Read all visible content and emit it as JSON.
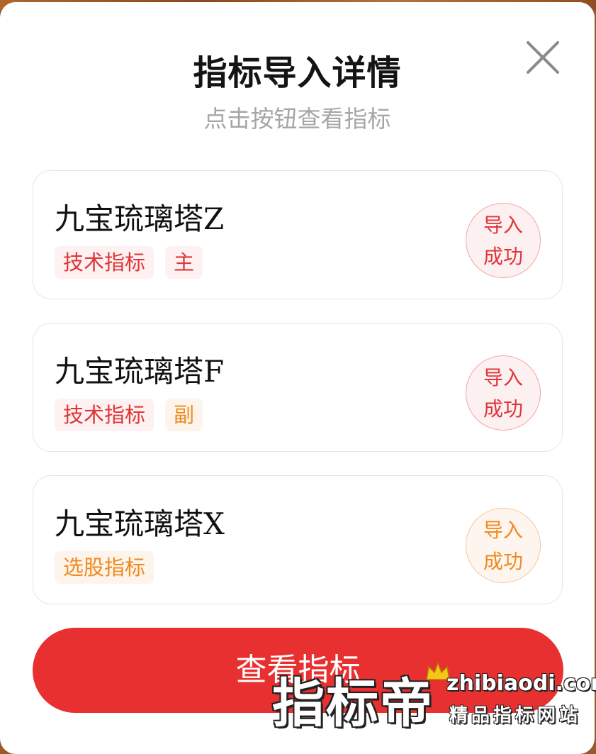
{
  "dialog": {
    "title": "指标导入详情",
    "subtitle": "点击按钮查看指标",
    "close_icon": "close-icon"
  },
  "items": [
    {
      "name": "九宝琉璃塔Z",
      "tags": [
        "技术指标",
        "主"
      ],
      "status": [
        "导入",
        "成功"
      ]
    },
    {
      "name": "九宝琉璃塔F",
      "tags": [
        "技术指标",
        "副"
      ],
      "status": [
        "导入",
        "成功"
      ]
    },
    {
      "name": "九宝琉璃塔X",
      "tags": [
        "选股指标"
      ],
      "status": [
        "导入",
        "成功"
      ]
    }
  ],
  "primary_button": {
    "label": "查看指标"
  },
  "watermark": {
    "brand": "指标帝",
    "url": "zhibiaodi.com",
    "tagline": "精品指标网站",
    "icon": "crown-icon"
  },
  "colors": {
    "accent_red": "#e83030",
    "tag_red_text": "#e0353a",
    "tag_orange_text": "#f08a1e",
    "subtitle_gray": "#a6a6a6"
  }
}
